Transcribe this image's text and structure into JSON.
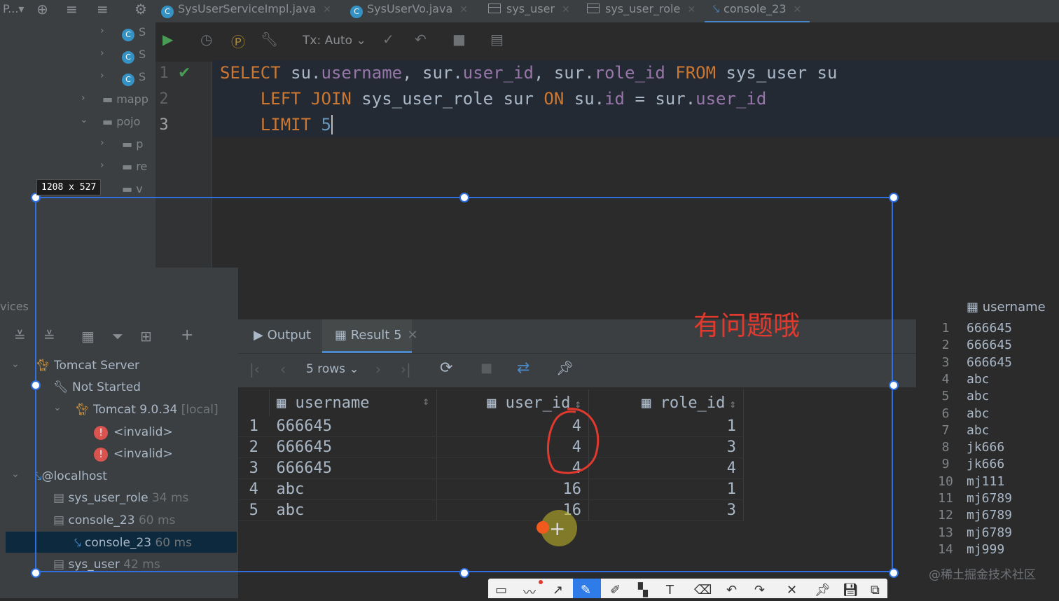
{
  "top_tabs": [
    {
      "label": "P...▾"
    },
    {
      "label": "SysUserServiceImpl.java"
    },
    {
      "label": "SysUserVo.java"
    },
    {
      "label": "sys_user"
    },
    {
      "label": "sys_user_role"
    },
    {
      "label": "console_23"
    }
  ],
  "project_tree": {
    "items": [
      "S",
      "S",
      "S",
      "mapp",
      "pojo",
      "p",
      "re",
      "v"
    ]
  },
  "editor_toolbar": {
    "tx_mode": "Tx: Auto"
  },
  "editor": {
    "line_numbers": [
      "1",
      "2",
      "3"
    ],
    "line1": {
      "select": "SELECT",
      "su1": " su.",
      "f1": "username",
      "c1": ", sur.",
      "f2": "user_id",
      "c2": ", sur.",
      "f3": "role_id",
      "from": " FROM",
      "tbl": " sys_user",
      "alias": " su"
    },
    "line2": {
      "left": "LEFT JOIN",
      "tbl": " sys_user_role",
      "alias": " sur",
      "on": " ON",
      "su": " su.",
      "f1": "id",
      "eq": " = sur.",
      "f2": "user_id"
    },
    "line3": {
      "limit": "LIMIT",
      "val": " 5"
    }
  },
  "services": {
    "side_label": "vices",
    "tomcat_server": "Tomcat Server",
    "not_started": "Not Started",
    "tomcat_version": "Tomcat 9.0.34",
    "tomcat_local": " [local]",
    "invalid1": "<invalid>",
    "invalid2": "<invalid>",
    "localhost": "@localhost",
    "sessions": [
      {
        "name": "sys_user_role",
        "time": " 34 ms"
      },
      {
        "name": "console_23",
        "time": " 60 ms"
      },
      {
        "name": "console_23",
        "time": " 60 ms"
      },
      {
        "name": "sys_user",
        "time": " 42 ms"
      }
    ]
  },
  "result_tabs": {
    "output": "Output",
    "result": "Result 5"
  },
  "result_toolbar": {
    "rows": "5 rows"
  },
  "result_table": {
    "columns": [
      "username",
      "user_id",
      "role_id"
    ],
    "rows": [
      {
        "n": "1",
        "username": "666645",
        "user_id": "4",
        "role_id": "1"
      },
      {
        "n": "2",
        "username": "666645",
        "user_id": "4",
        "role_id": "3"
      },
      {
        "n": "3",
        "username": "666645",
        "user_id": "4",
        "role_id": "4"
      },
      {
        "n": "4",
        "username": "abc",
        "user_id": "16",
        "role_id": "1"
      },
      {
        "n": "5",
        "username": "abc",
        "user_id": "16",
        "role_id": "3"
      }
    ]
  },
  "side_table": {
    "header": "username",
    "rows": [
      {
        "n": "1",
        "v": "666645"
      },
      {
        "n": "2",
        "v": "666645"
      },
      {
        "n": "3",
        "v": "666645"
      },
      {
        "n": "4",
        "v": "abc"
      },
      {
        "n": "5",
        "v": "abc"
      },
      {
        "n": "6",
        "v": "abc"
      },
      {
        "n": "7",
        "v": "abc"
      },
      {
        "n": "8",
        "v": "jk666"
      },
      {
        "n": "9",
        "v": "jk666"
      },
      {
        "n": "10",
        "v": "mj111"
      },
      {
        "n": "11",
        "v": "mj6789"
      },
      {
        "n": "12",
        "v": "mj6789"
      },
      {
        "n": "13",
        "v": "mj6789"
      },
      {
        "n": "14",
        "v": "mj999"
      }
    ]
  },
  "overlay": {
    "size_label": "1208 x 527",
    "annotation": "有问题哦",
    "watermark": "@稀土掘金技术社区"
  },
  "colors": {
    "accent": "#2f6fe0",
    "annotation": "#e03a2f",
    "keyword": "#cc7832",
    "field": "#9876aa"
  }
}
